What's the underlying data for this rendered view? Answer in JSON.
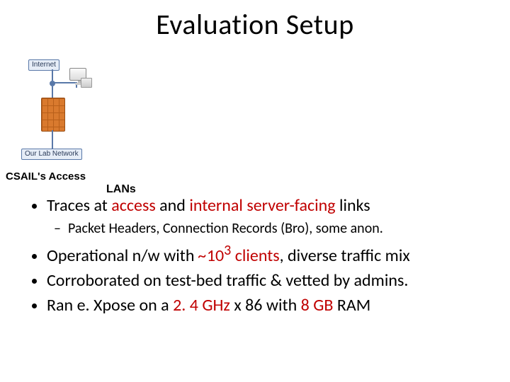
{
  "title": "Evaluation Setup",
  "diagram": {
    "internet_label": "Internet",
    "lab_label": "Our Lab Network"
  },
  "captions": {
    "access": "CSAIL's Access",
    "lans": "LANs"
  },
  "bullets": {
    "b1_pre": "Traces at ",
    "b1_access": "access",
    "b1_mid": " and ",
    "b1_internal": "internal server-facing",
    "b1_post": " links",
    "b1_sub": "Packet Headers, Connection Records (Bro), some anon.",
    "b2_pre": "Operational n/w with ",
    "b2_tilde": "~",
    "b2_num": "10",
    "b2_sup": "3",
    "b2_clients": " clients",
    "b2_post": ", diverse traffic mix",
    "b3": "Corroborated on test-bed traffic & vetted by admins.",
    "b4_pre": "Ran e. Xpose on a ",
    "b4_cpu": "2. 4 GHz",
    "b4_mid": " x 86 with ",
    "b4_ram": "8 GB",
    "b4_post": " RAM"
  }
}
